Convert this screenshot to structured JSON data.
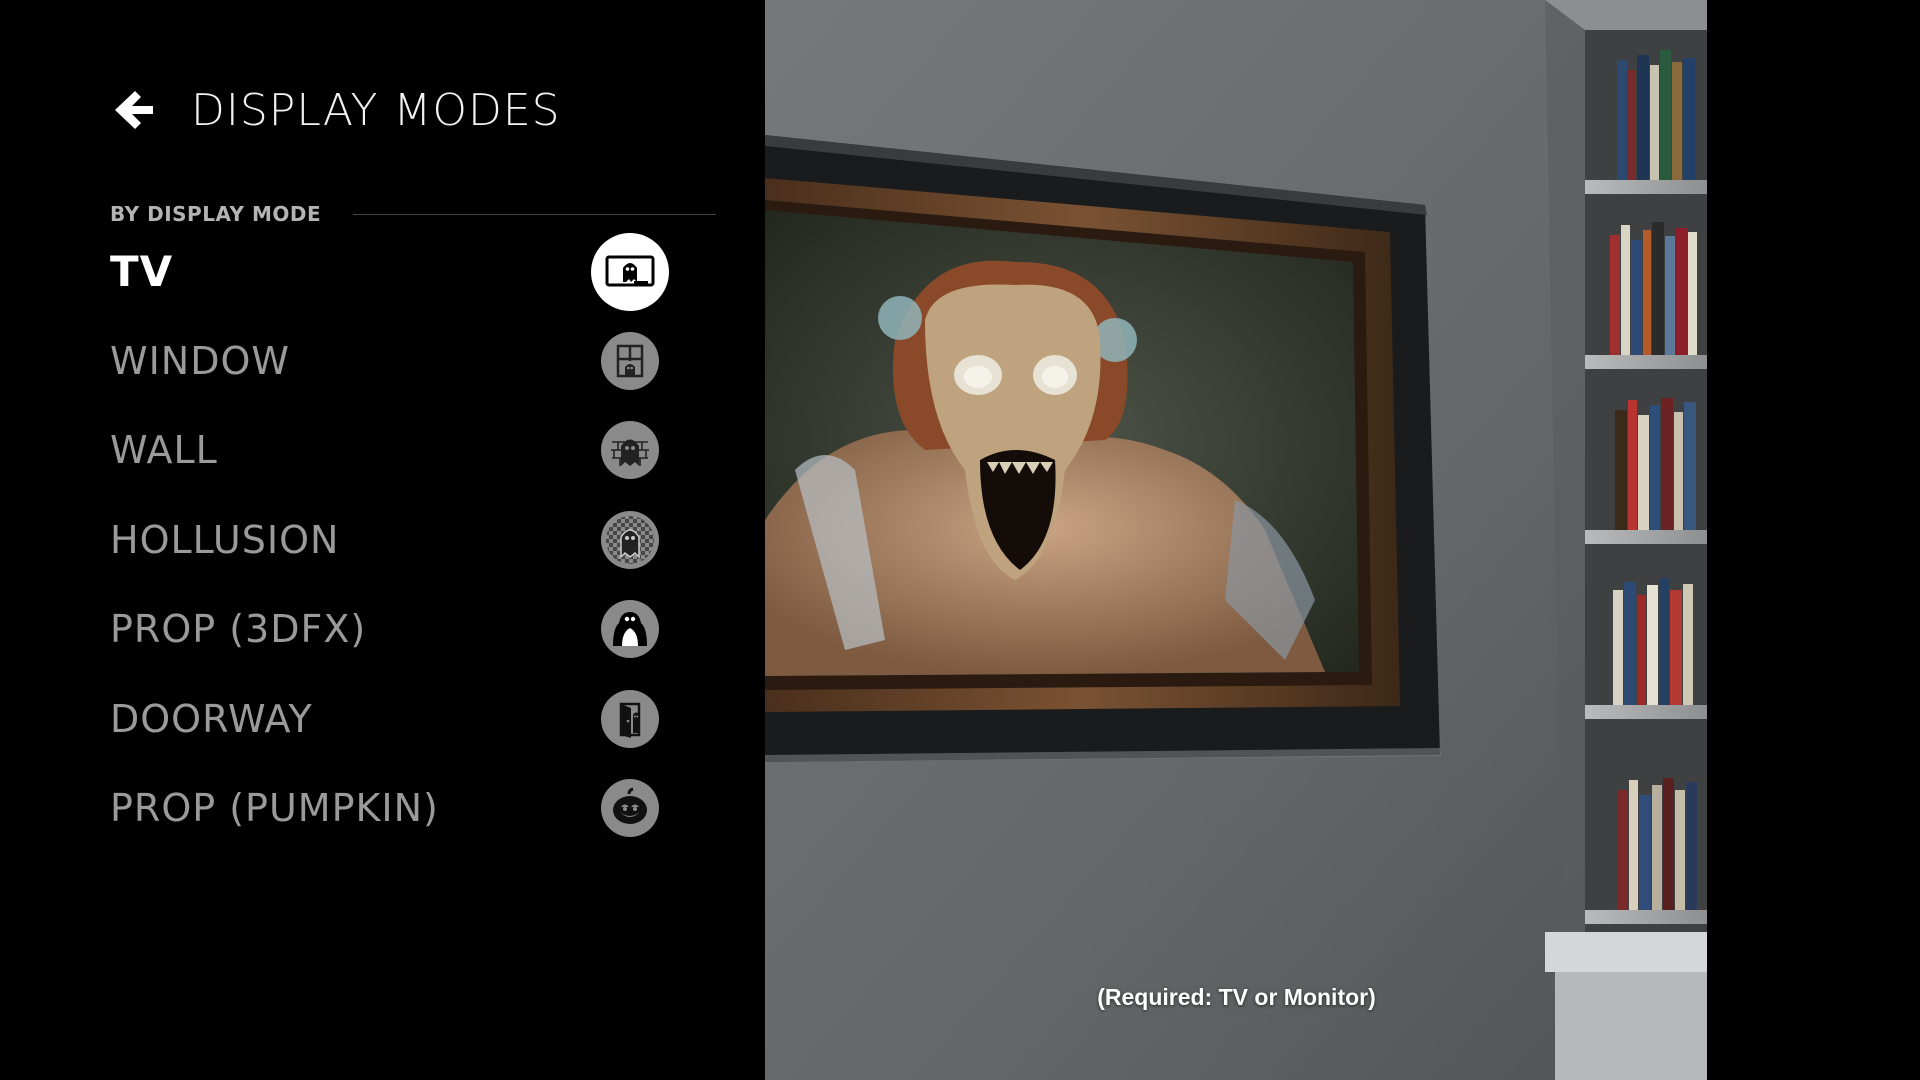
{
  "header": {
    "title": "DISPLAY MODES",
    "back_icon": "arrow-left-icon"
  },
  "section": {
    "label": "BY DISPLAY MODE"
  },
  "modes": [
    {
      "label": "TV",
      "icon": "tv-ghost-icon",
      "selected": true
    },
    {
      "label": "WINDOW",
      "icon": "window-ghost-icon",
      "selected": false
    },
    {
      "label": "WALL",
      "icon": "brick-wall-ghost-icon",
      "selected": false
    },
    {
      "label": "HOLLUSION",
      "icon": "hollusion-ghost-icon",
      "selected": false
    },
    {
      "label": "PROP (3DFX)",
      "icon": "ghost-prop-icon",
      "selected": false
    },
    {
      "label": "DOORWAY",
      "icon": "doorway-ghost-icon",
      "selected": false
    },
    {
      "label": "PROP (PUMPKIN)",
      "icon": "pumpkin-icon",
      "selected": false
    }
  ],
  "preview": {
    "caption": "(Required: TV or Monitor)"
  },
  "colors": {
    "background": "#000000",
    "active_text": "#ffffff",
    "inactive_text": "#9a9a9a",
    "active_icon_bg": "#ffffff",
    "inactive_icon_bg": "#8a8a8a"
  }
}
